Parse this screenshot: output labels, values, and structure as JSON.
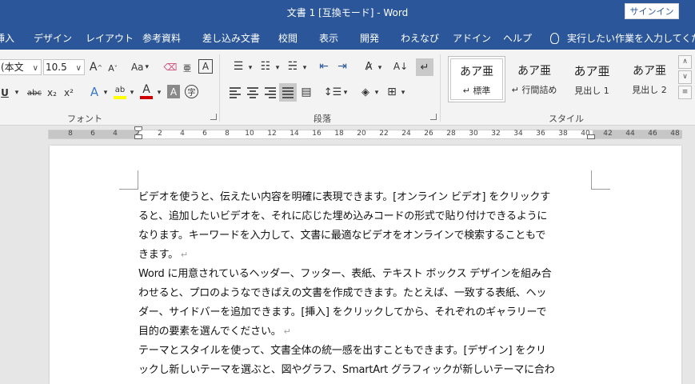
{
  "window": {
    "title": "文書 1 [互換モード] - Word",
    "signin": "サインイン"
  },
  "tabs": [
    "挿入",
    "デザイン",
    "レイアウト",
    "参考資料",
    "差し込み文書",
    "校閲",
    "表示",
    "開発",
    "わえなび",
    "アドイン",
    "ヘルプ"
  ],
  "tell_me": "実行したい作業を入力してください",
  "ribbon": {
    "font_group": {
      "label": "フォント",
      "font_name": "(本文",
      "font_size": "10.5",
      "grow": "A",
      "shrink": "A",
      "case": "Aa",
      "underline": "U",
      "strike": "abc",
      "sub": "x₂",
      "sup": "x²",
      "effects": "A",
      "highlight": "ab",
      "font_color": "A",
      "shade": "A",
      "enclose": "字"
    },
    "para_group": {
      "label": "段落"
    },
    "styles_group": {
      "label": "スタイル",
      "items": [
        {
          "sample": "あア亜",
          "name": "標準",
          "prefix": "↵"
        },
        {
          "sample": "あア亜",
          "name": "行間詰め",
          "prefix": "↵"
        },
        {
          "sample": "あア亜",
          "name": "見出し 1",
          "prefix": ""
        },
        {
          "sample": "あア亜",
          "name": "見出し 2",
          "prefix": ""
        }
      ]
    },
    "colors": {
      "accent": "#2b579a",
      "highlight": "#ffff00",
      "font_color": "#d00000"
    }
  },
  "ruler": {
    "left_numbers": [
      "8",
      "6",
      "4",
      "2"
    ],
    "right_numbers": [
      "2",
      "4",
      "6",
      "8",
      "10",
      "12",
      "14",
      "16",
      "18",
      "20",
      "22",
      "24",
      "26",
      "28",
      "30",
      "32",
      "34",
      "36",
      "38",
      "40",
      "42",
      "44",
      "46",
      "48"
    ]
  },
  "document": {
    "paragraph_mark": "↵",
    "lines": [
      "ビデオを使うと、伝えたい内容を明確に表現できます。[オンライン ビデオ] をクリックす",
      "ると、追加したいビデオを、それに応じた埋め込みコードの形式で貼り付けできるように",
      "なります。キーワードを入力して、文書に最適なビデオをオンラインで検索することもで",
      "きます。",
      "Word に用意されているヘッダー、フッター、表紙、テキスト ボックス デザインを組み合",
      "わせると、プロのようなできばえの文書を作成できます。たとえば、一致する表紙、ヘッ",
      "ダー、サイドバーを追加できます。[挿入] をクリックしてから、それぞれのギャラリーで",
      "目的の要素を選んでください。",
      "テーマとスタイルを使って、文書全体の統一感を出すこともできます。[デザイン] をクリ",
      "ックし新しいテーマを選ぶと、図やグラフ、SmartArt グラフィックが新しいテーマに合わ"
    ]
  }
}
